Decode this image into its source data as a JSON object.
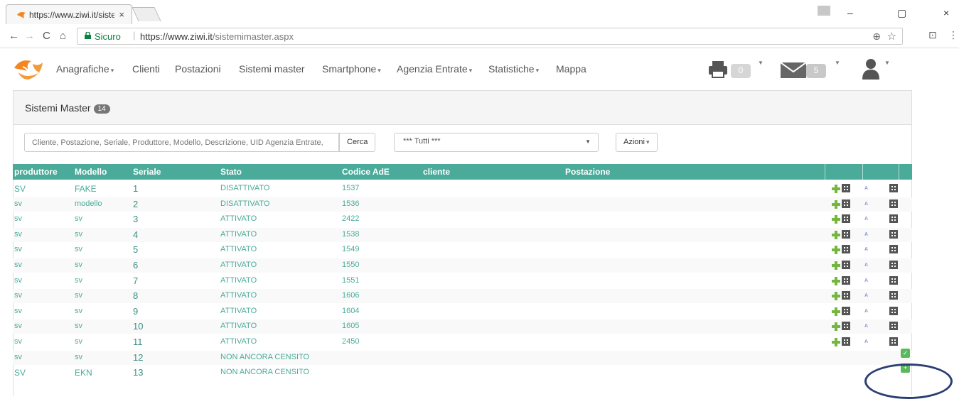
{
  "browser": {
    "tab_title": "https://www.ziwi.it/sisten",
    "tab_close": "×",
    "url_secure_label": "Sicuro",
    "url_host": "https://www.ziwi.it",
    "url_path": "/sistemimaster.aspx",
    "back": "←",
    "forward": "→",
    "reload": "C",
    "home": "⌂",
    "zoom_icon": "⊕",
    "star_icon": "☆",
    "cast_icon": "⊡",
    "menu_icon": "⋮",
    "minimize": "–",
    "maximize": "▢",
    "close": "×"
  },
  "navbar": {
    "items": [
      {
        "label": "Anagrafiche",
        "dropdown": true
      },
      {
        "label": "Clienti",
        "dropdown": false
      },
      {
        "label": "Postazioni",
        "dropdown": false
      },
      {
        "label": "Sistemi master",
        "dropdown": false
      },
      {
        "label": "Smartphone",
        "dropdown": true
      },
      {
        "label": "Agenzia Entrate",
        "dropdown": true
      },
      {
        "label": "Statistiche",
        "dropdown": true
      },
      {
        "label": "Mappa",
        "dropdown": false
      }
    ],
    "printer_count": "0",
    "mail_count": "5"
  },
  "panel": {
    "title": "Sistemi Master",
    "count": "14"
  },
  "search": {
    "placeholder": "Cliente, Postazione, Seriale, Produttore, Modello, Descrizione, UID Agenzia Entrate,",
    "button": "Cerca",
    "filter_selected": "*** Tutti ***",
    "actions_button": "Azioni"
  },
  "table": {
    "headers": [
      "produttore",
      "Modello",
      "Seriale",
      "Stato",
      "Codice AdE",
      "cliente",
      "Postazione"
    ],
    "rows": [
      {
        "produttore": "SV",
        "modello": "FAKE",
        "seriale": "1",
        "stato": "DISATTIVATO",
        "codice": "1537",
        "cliente": "",
        "postazione": "",
        "actions": "full"
      },
      {
        "produttore": "sv",
        "modello": "modello",
        "seriale": "2",
        "stato": "DISATTIVATO",
        "codice": "1536",
        "cliente": "",
        "postazione": "",
        "actions": "full"
      },
      {
        "produttore": "sv",
        "modello": "sv",
        "seriale": "3",
        "stato": "ATTIVATO",
        "codice": "2422",
        "cliente": "",
        "postazione": "",
        "actions": "full"
      },
      {
        "produttore": "sv",
        "modello": "sv",
        "seriale": "4",
        "stato": "ATTIVATO",
        "codice": "1538",
        "cliente": "",
        "postazione": "",
        "actions": "full"
      },
      {
        "produttore": "sv",
        "modello": "sv",
        "seriale": "5",
        "stato": "ATTIVATO",
        "codice": "1549",
        "cliente": "",
        "postazione": "",
        "actions": "full"
      },
      {
        "produttore": "sv",
        "modello": "sv",
        "seriale": "6",
        "stato": "ATTIVATO",
        "codice": "1550",
        "cliente": "",
        "postazione": "",
        "actions": "full"
      },
      {
        "produttore": "sv",
        "modello": "sv",
        "seriale": "7",
        "stato": "ATTIVATO",
        "codice": "1551",
        "cliente": "",
        "postazione": "",
        "actions": "full"
      },
      {
        "produttore": "sv",
        "modello": "sv",
        "seriale": "8",
        "stato": "ATTIVATO",
        "codice": "1606",
        "cliente": "",
        "postazione": "",
        "actions": "full"
      },
      {
        "produttore": "sv",
        "modello": "sv",
        "seriale": "9",
        "stato": "ATTIVATO",
        "codice": "1604",
        "cliente": "",
        "postazione": "",
        "actions": "full"
      },
      {
        "produttore": "sv",
        "modello": "sv",
        "seriale": "10",
        "stato": "ATTIVATO",
        "codice": "1605",
        "cliente": "",
        "postazione": "",
        "actions": "full"
      },
      {
        "produttore": "sv",
        "modello": "sv",
        "seriale": "11",
        "stato": "ATTIVATO",
        "codice": "2450",
        "cliente": "",
        "postazione": "",
        "actions": "full"
      },
      {
        "produttore": "sv",
        "modello": "sv",
        "seriale": "12",
        "stato": "NON ANCORA CENSITO",
        "codice": "",
        "cliente": "",
        "postazione": "",
        "actions": "check"
      },
      {
        "produttore": "SV",
        "modello": "EKN",
        "seriale": "13",
        "stato": "NON ANCORA CENSITO",
        "codice": "",
        "cliente": "",
        "postazione": "",
        "actions": "add"
      }
    ]
  },
  "icons": {
    "ade_mark": "A",
    "check": "✓",
    "add": "+"
  },
  "colors": {
    "table_header": "#4aab9a",
    "link_text": "#4aab9a",
    "action_green": "#5cb85c",
    "annotation_circle": "#2b3f73"
  }
}
